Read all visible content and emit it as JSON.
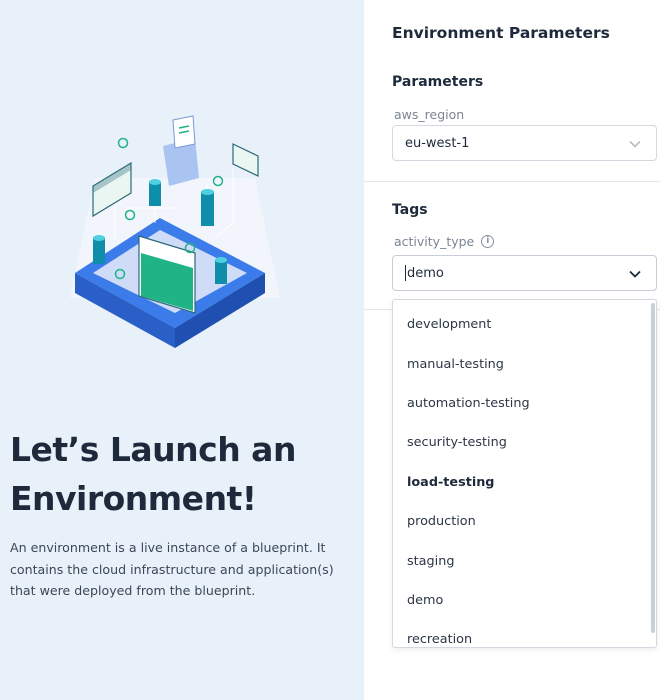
{
  "hero": {
    "title": "Let’s Launch an Environment!",
    "description": "An environment is a live instance of a blueprint. It contains the cloud infrastructure and application(s) that were deployed from the blueprint."
  },
  "panel": {
    "title": "Environment Parameters",
    "parameters_section": "Parameters",
    "aws_region_label": "aws_region",
    "aws_region_value": "eu-west-1",
    "tags_section": "Tags",
    "activity_type_label": "activity_type",
    "activity_type_value": "demo",
    "info_glyph": "i"
  },
  "dropdown": {
    "options": [
      "development",
      "manual-testing",
      "automation-testing",
      "security-testing",
      "load-testing",
      "production",
      "staging",
      "demo",
      "recreation"
    ],
    "hovered": "load-testing"
  },
  "colors": {
    "left_bg": "#e8f0fa",
    "text": "#1e2a3b",
    "accent_green": "#20b386",
    "accent_blue": "#2f6fe4"
  }
}
